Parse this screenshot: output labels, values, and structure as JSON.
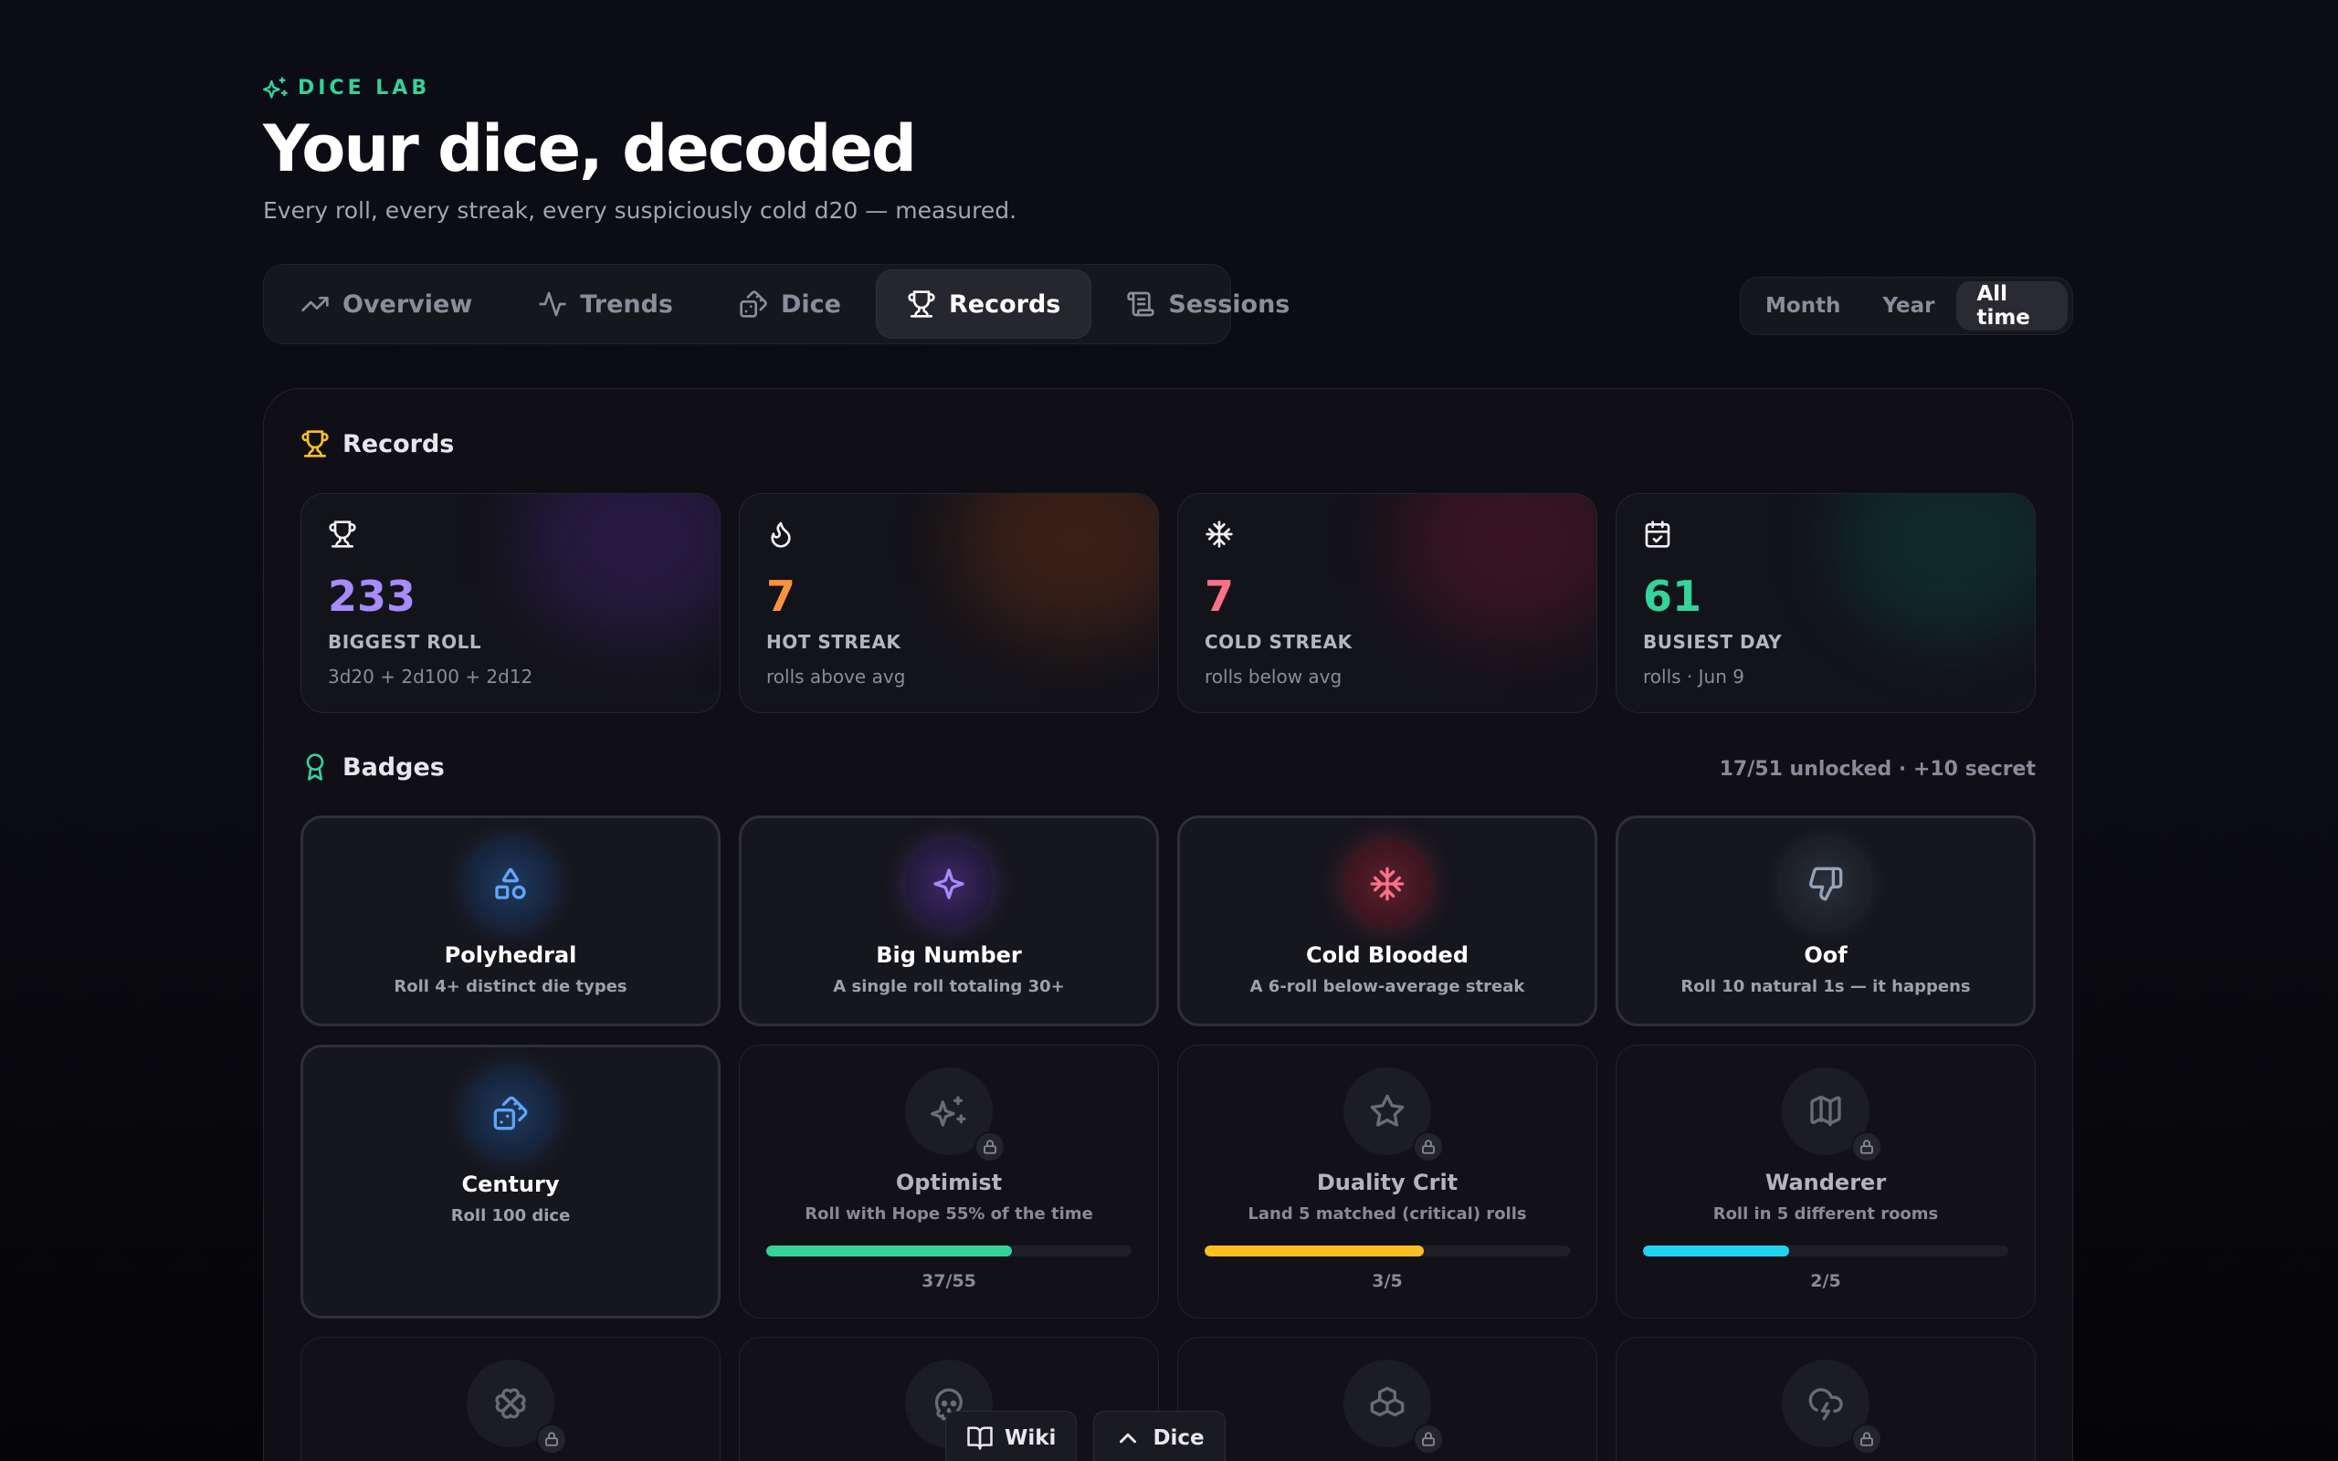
{
  "brand": {
    "name": "DICE LAB",
    "icon": "sparkles-icon",
    "color": "#34d399"
  },
  "header": {
    "title": "Your dice, decoded",
    "subtitle": "Every roll, every streak, every suspiciously cold d20 — measured."
  },
  "tabs": [
    {
      "label": "Overview",
      "icon": "trending-up-icon"
    },
    {
      "label": "Trends",
      "icon": "activity-icon"
    },
    {
      "label": "Dice",
      "icon": "dice-icon"
    },
    {
      "label": "Records",
      "icon": "trophy-icon",
      "active": true
    },
    {
      "label": "Sessions",
      "icon": "scroll-icon"
    }
  ],
  "period": {
    "options": [
      "Month",
      "Year",
      "All time"
    ],
    "selected": "All time"
  },
  "records_section": {
    "title": "Records",
    "icon": "trophy-icon",
    "items": [
      {
        "value": "233",
        "label": "BIGGEST ROLL",
        "sub": "3d20 + 2d100 + 2d12",
        "icon": "trophy-icon",
        "color": "#a78bfa"
      },
      {
        "value": "7",
        "label": "HOT STREAK",
        "sub": "rolls above avg",
        "icon": "flame-icon",
        "color": "#fb923c"
      },
      {
        "value": "7",
        "label": "COLD STREAK",
        "sub": "rolls below avg",
        "icon": "snowflake-icon",
        "color": "#fb7185"
      },
      {
        "value": "61",
        "label": "BUSIEST DAY",
        "sub": "rolls · Jun 9",
        "icon": "calendar-check-icon",
        "color": "#34d399"
      }
    ]
  },
  "badges_section": {
    "title": "Badges",
    "icon": "award-icon",
    "summary": "17/51 unlocked · +10 secret",
    "items": [
      {
        "name": "Polyhedral",
        "desc": "Roll 4+ distinct die types",
        "icon": "shapes-icon",
        "unlocked": true,
        "color": "#60a5fa"
      },
      {
        "name": "Big Number",
        "desc": "A single roll totaling 30+",
        "icon": "sparkle-icon",
        "unlocked": true,
        "color": "#a78bfa"
      },
      {
        "name": "Cold Blooded",
        "desc": "A 6-roll below-average streak",
        "icon": "snowflake-icon",
        "unlocked": true,
        "color": "#fb7185"
      },
      {
        "name": "Oof",
        "desc": "Roll 10 natural 1s — it happens",
        "icon": "thumbs-down-icon",
        "unlocked": true,
        "color": "#94a3b8"
      },
      {
        "name": "Century",
        "desc": "Roll 100 dice",
        "icon": "dice-icon",
        "unlocked": true,
        "color": "#60a5fa"
      },
      {
        "name": "Optimist",
        "desc": "Roll with Hope 55% of the time",
        "icon": "sparkles-icon",
        "unlocked": false,
        "progress": 0.673,
        "progress_text": "37/55",
        "color": "#34d399"
      },
      {
        "name": "Duality Crit",
        "desc": "Land 5 matched (critical) rolls",
        "icon": "star-icon",
        "unlocked": false,
        "progress": 0.6,
        "progress_text": "3/5",
        "color": "#fbbf24"
      },
      {
        "name": "Wanderer",
        "desc": "Roll in 5 different rooms",
        "icon": "map-icon",
        "unlocked": false,
        "progress": 0.4,
        "progress_text": "2/5",
        "color": "#22d3ee"
      },
      {
        "icon": "clover-icon",
        "unlocked": false
      },
      {
        "icon": "skull-icon",
        "unlocked": false
      },
      {
        "icon": "boxes-icon",
        "unlocked": false
      },
      {
        "icon": "cloud-lightning-icon",
        "unlocked": false
      }
    ]
  },
  "dock": [
    {
      "label": "Wiki",
      "icon": "book-open-icon"
    },
    {
      "label": "Dice",
      "icon": "chevron-up-icon"
    }
  ]
}
